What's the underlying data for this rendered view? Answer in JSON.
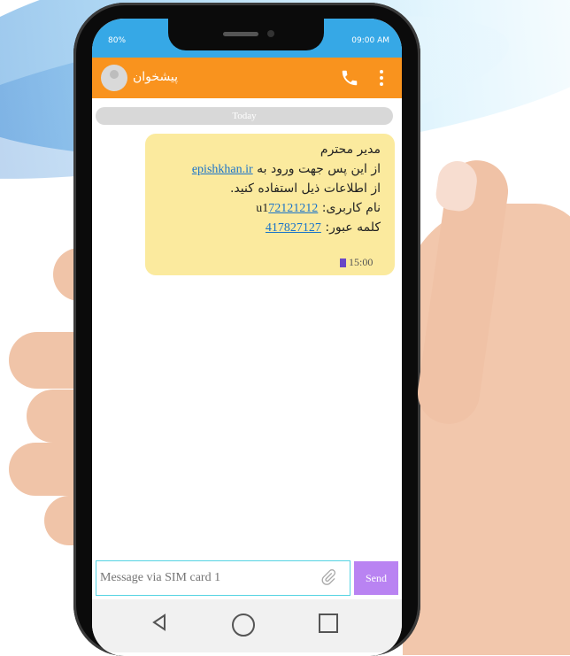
{
  "status_bar": {
    "battery": "80%",
    "time": "09:00 AM"
  },
  "header": {
    "contact_name": "پیشخوان"
  },
  "conversation": {
    "day_label": "Today"
  },
  "message": {
    "line1": "مدیر محترم",
    "line2_text": "از این پس جهت ورود به ",
    "line2_link": "epishkhan.ir",
    "line3": "از اطلاعات ذیل استفاده کنید.",
    "line4_label": "نام کاربری: ",
    "line4_value_link": "72121212",
    "line4_suffix": "u1",
    "line5_label": "کلمه عبور: ",
    "line5_value_link": "417827127",
    "time": "15:00"
  },
  "composer": {
    "placeholder": "Message via SIM card 1",
    "send_label": "Send"
  },
  "icons": {
    "call": "phone-icon",
    "menu": "more-vertical-icon",
    "attach": "paperclip-icon",
    "back": "triangle-back-icon",
    "home": "circle-home-icon",
    "recent": "square-recent-icon"
  },
  "colors": {
    "header": "#f9931e",
    "status_bar": "#36a8e6",
    "bubble": "#fbea9e",
    "send": "#b983f2",
    "link": "#1a73c9"
  }
}
